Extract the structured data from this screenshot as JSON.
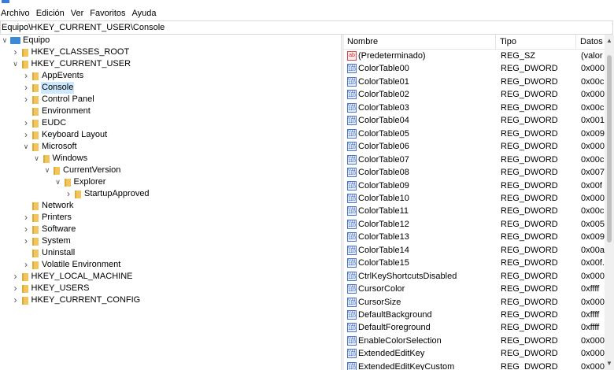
{
  "menu": [
    "Archivo",
    "Edición",
    "Ver",
    "Favoritos",
    "Ayuda"
  ],
  "address": "Equipo\\HKEY_CURRENT_USER\\Console",
  "tree": [
    {
      "label": "Equipo",
      "level": 0,
      "expander": "expanded",
      "icon": "computer-icon"
    },
    {
      "label": "HKEY_CLASSES_ROOT",
      "level": 1,
      "expander": "collapsed",
      "icon": "folder-icon"
    },
    {
      "label": "HKEY_CURRENT_USER",
      "level": 1,
      "expander": "expanded",
      "icon": "folder-icon"
    },
    {
      "label": "AppEvents",
      "level": 2,
      "expander": "collapsed",
      "icon": "folder-icon"
    },
    {
      "label": "Console",
      "level": 2,
      "expander": "collapsed",
      "icon": "folder-icon",
      "selected": true
    },
    {
      "label": "Control Panel",
      "level": 2,
      "expander": "collapsed",
      "icon": "folder-icon"
    },
    {
      "label": "Environment",
      "level": 2,
      "expander": "none",
      "icon": "folder-icon"
    },
    {
      "label": "EUDC",
      "level": 2,
      "expander": "collapsed",
      "icon": "folder-icon"
    },
    {
      "label": "Keyboard Layout",
      "level": 2,
      "expander": "collapsed",
      "icon": "folder-icon"
    },
    {
      "label": "Microsoft",
      "level": 2,
      "expander": "expanded",
      "icon": "folder-icon"
    },
    {
      "label": "Windows",
      "level": 3,
      "expander": "expanded",
      "icon": "folder-icon"
    },
    {
      "label": "CurrentVersion",
      "level": 4,
      "expander": "expanded",
      "icon": "folder-icon"
    },
    {
      "label": "Explorer",
      "level": 5,
      "expander": "expanded",
      "icon": "folder-icon"
    },
    {
      "label": "StartupApproved",
      "level": 6,
      "expander": "collapsed",
      "icon": "folder-icon"
    },
    {
      "label": "Network",
      "level": 2,
      "expander": "none",
      "icon": "folder-icon"
    },
    {
      "label": "Printers",
      "level": 2,
      "expander": "collapsed",
      "icon": "folder-icon"
    },
    {
      "label": "Software",
      "level": 2,
      "expander": "collapsed",
      "icon": "folder-icon"
    },
    {
      "label": "System",
      "level": 2,
      "expander": "collapsed",
      "icon": "folder-icon"
    },
    {
      "label": "Uninstall",
      "level": 2,
      "expander": "none",
      "icon": "folder-icon"
    },
    {
      "label": "Volatile Environment",
      "level": 2,
      "expander": "collapsed",
      "icon": "folder-icon"
    },
    {
      "label": "HKEY_LOCAL_MACHINE",
      "level": 1,
      "expander": "collapsed",
      "icon": "folder-icon"
    },
    {
      "label": "HKEY_USERS",
      "level": 1,
      "expander": "collapsed",
      "icon": "folder-icon"
    },
    {
      "label": "HKEY_CURRENT_CONFIG",
      "level": 1,
      "expander": "collapsed",
      "icon": "folder-icon"
    }
  ],
  "columns": {
    "name": "Nombre",
    "type": "Tipo",
    "data": "Datos"
  },
  "values": [
    {
      "name": "(Predeterminado)",
      "type": "REG_SZ",
      "data": "(valor",
      "icon": "string-value-icon"
    },
    {
      "name": "ColorTable00",
      "type": "REG_DWORD",
      "data": "0x000",
      "icon": "dword-value-icon"
    },
    {
      "name": "ColorTable01",
      "type": "REG_DWORD",
      "data": "0x00c",
      "icon": "dword-value-icon"
    },
    {
      "name": "ColorTable02",
      "type": "REG_DWORD",
      "data": "0x000",
      "icon": "dword-value-icon"
    },
    {
      "name": "ColorTable03",
      "type": "REG_DWORD",
      "data": "0x00c",
      "icon": "dword-value-icon"
    },
    {
      "name": "ColorTable04",
      "type": "REG_DWORD",
      "data": "0x001",
      "icon": "dword-value-icon"
    },
    {
      "name": "ColorTable05",
      "type": "REG_DWORD",
      "data": "0x009",
      "icon": "dword-value-icon"
    },
    {
      "name": "ColorTable06",
      "type": "REG_DWORD",
      "data": "0x000",
      "icon": "dword-value-icon"
    },
    {
      "name": "ColorTable07",
      "type": "REG_DWORD",
      "data": "0x00c",
      "icon": "dword-value-icon"
    },
    {
      "name": "ColorTable08",
      "type": "REG_DWORD",
      "data": "0x007",
      "icon": "dword-value-icon"
    },
    {
      "name": "ColorTable09",
      "type": "REG_DWORD",
      "data": "0x00f",
      "icon": "dword-value-icon"
    },
    {
      "name": "ColorTable10",
      "type": "REG_DWORD",
      "data": "0x000",
      "icon": "dword-value-icon"
    },
    {
      "name": "ColorTable11",
      "type": "REG_DWORD",
      "data": "0x00c",
      "icon": "dword-value-icon"
    },
    {
      "name": "ColorTable12",
      "type": "REG_DWORD",
      "data": "0x005",
      "icon": "dword-value-icon"
    },
    {
      "name": "ColorTable13",
      "type": "REG_DWORD",
      "data": "0x009",
      "icon": "dword-value-icon"
    },
    {
      "name": "ColorTable14",
      "type": "REG_DWORD",
      "data": "0x00a",
      "icon": "dword-value-icon"
    },
    {
      "name": "ColorTable15",
      "type": "REG_DWORD",
      "data": "0x00f.",
      "icon": "dword-value-icon"
    },
    {
      "name": "CtrlKeyShortcutsDisabled",
      "type": "REG_DWORD",
      "data": "0x000",
      "icon": "dword-value-icon"
    },
    {
      "name": "CursorColor",
      "type": "REG_DWORD",
      "data": "0xffff",
      "icon": "dword-value-icon"
    },
    {
      "name": "CursorSize",
      "type": "REG_DWORD",
      "data": "0x000",
      "icon": "dword-value-icon"
    },
    {
      "name": "DefaultBackground",
      "type": "REG_DWORD",
      "data": "0xffff",
      "icon": "dword-value-icon"
    },
    {
      "name": "DefaultForeground",
      "type": "REG_DWORD",
      "data": "0xffff",
      "icon": "dword-value-icon"
    },
    {
      "name": "EnableColorSelection",
      "type": "REG_DWORD",
      "data": "0x000",
      "icon": "dword-value-icon"
    },
    {
      "name": "ExtendedEditKey",
      "type": "REG_DWORD",
      "data": "0x000",
      "icon": "dword-value-icon"
    },
    {
      "name": "ExtendedEditKeyCustom",
      "type": "REG_DWORD",
      "data": "0x000",
      "icon": "dword-value-icon"
    }
  ],
  "colors": {
    "selection": "#cce8ff",
    "folder": "#f2c55c",
    "scroll_thumb": "#c1c1c1"
  }
}
